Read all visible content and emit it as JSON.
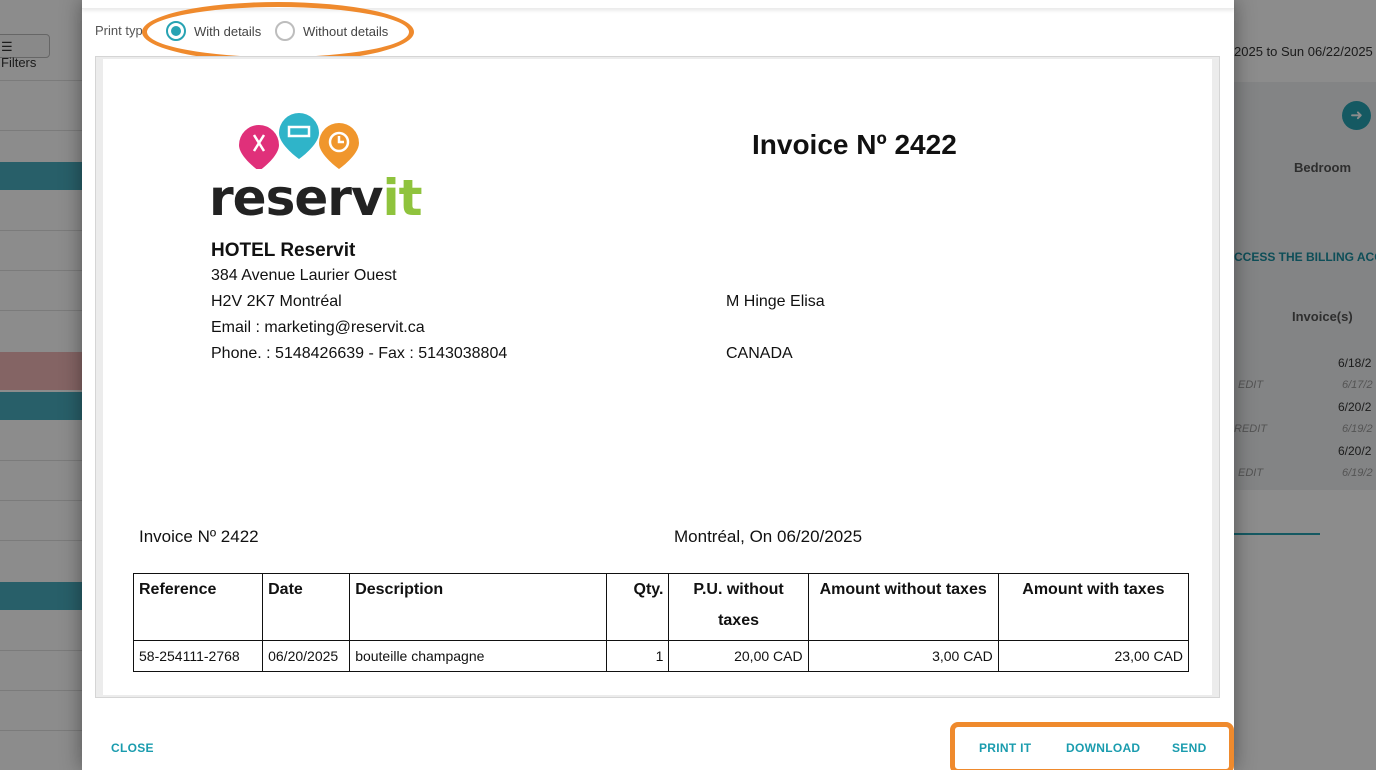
{
  "background": {
    "filters_label": "Filters",
    "date_range": "2025 to Sun 06/22/2025",
    "bedroom_header": "Bedroom",
    "access_billing": "CCESS THE BILLING ACC",
    "invoices_header": "Invoice(s)",
    "rows": [
      {
        "date": "6/18/2",
        "tag": ""
      },
      {
        "date": "6/17/2",
        "tag": "EDIT"
      },
      {
        "date": "6/20/2",
        "tag": ""
      },
      {
        "date": "6/19/2",
        "tag": "REDIT"
      },
      {
        "date": "6/20/2",
        "tag": ""
      },
      {
        "date": "6/19/2",
        "tag": "EDIT"
      }
    ]
  },
  "print_type": {
    "label": "Print typ",
    "options": [
      {
        "label": "With details",
        "checked": true
      },
      {
        "label": "Without details",
        "checked": false
      }
    ]
  },
  "invoice": {
    "logo_text_main": "reserv",
    "logo_text_accent": "it",
    "title": "Invoice Nº 2422",
    "hotel": {
      "name": "HOTEL Reservit",
      "address1": "384 Avenue Laurier Ouest",
      "address2": "H2V 2K7 Montréal",
      "email": "Email : marketing@reservit.ca",
      "phone": "Phone. : 5148426639 - Fax : 5143038804"
    },
    "client": {
      "name": "M Hinge Elisa",
      "country": "CANADA"
    },
    "subtitle": "Invoice Nº 2422",
    "place_date": "Montréal, On 06/20/2025",
    "table": {
      "headers": {
        "reference": "Reference",
        "date": "Date",
        "description": "Description",
        "qty": "Qty.",
        "pu": "P.U. without taxes",
        "amount_wo": "Amount without taxes",
        "amount_w": "Amount with taxes"
      },
      "rows": [
        {
          "reference": "58-254111-2768",
          "date": "06/20/2025",
          "description": "bouteille champagne",
          "qty": "1",
          "pu": "20,00 CAD",
          "amount_wo": "3,00 CAD",
          "amount_w": "23,00 CAD"
        }
      ]
    }
  },
  "footer": {
    "close": "CLOSE",
    "print": "PRINT IT",
    "download": "DOWNLOAD",
    "send": "SEND"
  },
  "colors": {
    "accent": "#27a3b3",
    "highlight": "#ef8a2d",
    "logo_pink": "#e0307a",
    "logo_blue": "#2fb4c9",
    "logo_orange": "#f0962c",
    "logo_green": "#8fc33d"
  }
}
